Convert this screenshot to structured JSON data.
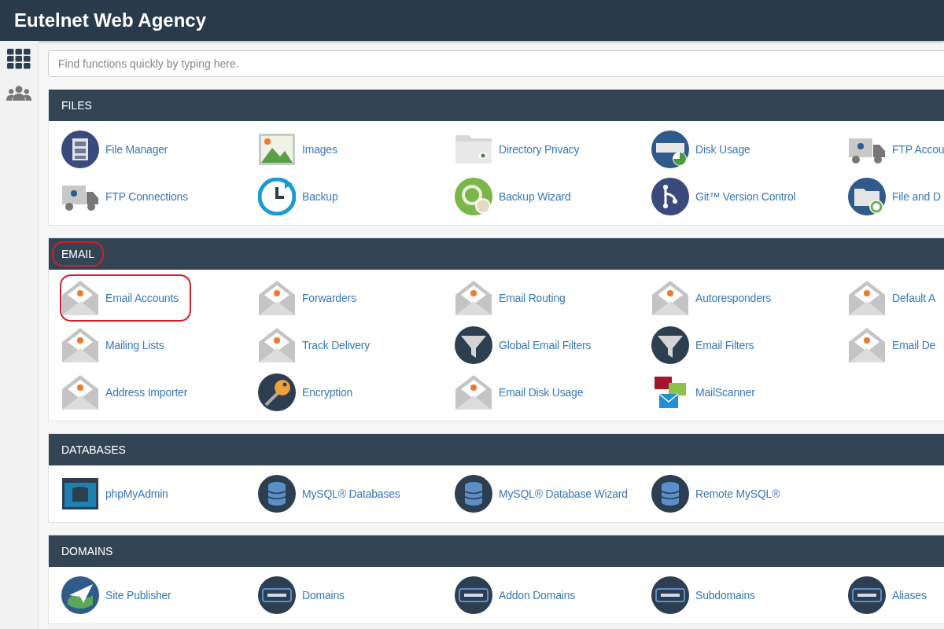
{
  "header": {
    "title": "Eutelnet Web Agency"
  },
  "sidebar": {
    "items": [
      {
        "kind": "grid",
        "selected": true
      },
      {
        "kind": "users",
        "selected": false
      }
    ]
  },
  "search": {
    "placeholder": "Find functions quickly by typing here."
  },
  "sections": [
    {
      "title": "FILES",
      "highlighted": false,
      "items": [
        {
          "label": "File Manager",
          "kind": "cabinet",
          "highlighted": false
        },
        {
          "label": "Images",
          "kind": "picture",
          "highlighted": false
        },
        {
          "label": "Directory Privacy",
          "kind": "folder",
          "highlighted": false
        },
        {
          "label": "Disk Usage",
          "kind": "disk",
          "highlighted": false
        },
        {
          "label": "FTP Accou",
          "kind": "truck",
          "highlighted": false
        },
        {
          "label": "FTP Connections",
          "kind": "truck",
          "highlighted": false
        },
        {
          "label": "Backup",
          "kind": "clock",
          "highlighted": false
        },
        {
          "label": "Backup Wizard",
          "kind": "wizard",
          "highlighted": false
        },
        {
          "label": "Git™ Version Control",
          "kind": "branch",
          "highlighted": false
        },
        {
          "label": "File and D",
          "kind": "folder-circle",
          "highlighted": false
        }
      ]
    },
    {
      "title": "EMAIL",
      "highlighted": true,
      "items": [
        {
          "label": "Email Accounts",
          "kind": "envelope",
          "highlighted": true
        },
        {
          "label": "Forwarders",
          "kind": "envelope",
          "highlighted": false
        },
        {
          "label": "Email Routing",
          "kind": "envelope",
          "highlighted": false
        },
        {
          "label": "Autoresponders",
          "kind": "envelope",
          "highlighted": false
        },
        {
          "label": "Default A",
          "kind": "envelope",
          "highlighted": false
        },
        {
          "label": "Mailing Lists",
          "kind": "envelope",
          "highlighted": false
        },
        {
          "label": "Track Delivery",
          "kind": "envelope",
          "highlighted": false
        },
        {
          "label": "Global Email Filters",
          "kind": "filter",
          "highlighted": false
        },
        {
          "label": "Email Filters",
          "kind": "filter",
          "highlighted": false
        },
        {
          "label": "Email De",
          "kind": "envelope",
          "highlighted": false
        },
        {
          "label": "Address Importer",
          "kind": "envelope",
          "highlighted": false
        },
        {
          "label": "Encryption",
          "kind": "key",
          "highlighted": false
        },
        {
          "label": "Email Disk Usage",
          "kind": "envelope",
          "highlighted": false
        },
        {
          "label": "MailScanner",
          "kind": "mailscanner",
          "highlighted": false
        }
      ]
    },
    {
      "title": "DATABASES",
      "highlighted": false,
      "items": [
        {
          "label": "phpMyAdmin",
          "kind": "screen",
          "highlighted": false
        },
        {
          "label": "MySQL® Databases",
          "kind": "database",
          "highlighted": false
        },
        {
          "label": "MySQL® Database Wizard",
          "kind": "database",
          "highlighted": false
        },
        {
          "label": "Remote MySQL®",
          "kind": "database",
          "highlighted": false
        }
      ]
    },
    {
      "title": "DOMAINS",
      "highlighted": false,
      "items": [
        {
          "label": "Site Publisher",
          "kind": "globe",
          "highlighted": false
        },
        {
          "label": "Domains",
          "kind": "dotcom",
          "highlighted": false
        },
        {
          "label": "Addon Domains",
          "kind": "dotcom",
          "highlighted": false
        },
        {
          "label": "Subdomains",
          "kind": "dotcom",
          "highlighted": false
        },
        {
          "label": "Aliases",
          "kind": "dotcom",
          "highlighted": false
        }
      ]
    }
  ]
}
